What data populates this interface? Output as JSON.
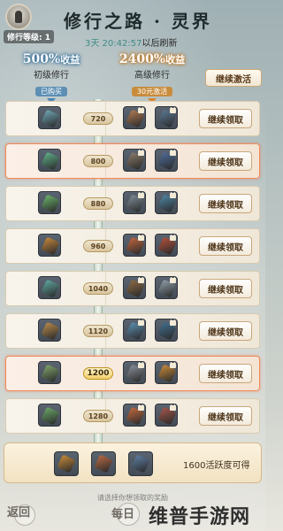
{
  "header": {
    "title": "修行之路 · 灵界",
    "level_label": "修行等级: 1",
    "refresh_countdown": "3天 20:42:57",
    "refresh_suffix": "以后刷新"
  },
  "tiers": {
    "basic": {
      "percent": "500%",
      "bonus": "收益",
      "name": "初级修行",
      "status": "已购买"
    },
    "advanced": {
      "percent": "2400%",
      "bonus": "收益",
      "name": "高级修行",
      "status": "30元激活"
    },
    "activate_button": "继续激活"
  },
  "rows": [
    {
      "threshold": "720",
      "claim": "继续领取",
      "highlighted": false,
      "active_node": false,
      "colors": [
        "#6fa6b5",
        "#b07a52",
        "#5c7a94"
      ]
    },
    {
      "threshold": "800",
      "claim": "继续领取",
      "highlighted": true,
      "active_node": false,
      "colors": [
        "#5fb08a",
        "#8a7a6a",
        "#4e6c9a"
      ]
    },
    {
      "threshold": "880",
      "claim": "继续领取",
      "highlighted": false,
      "active_node": false,
      "colors": [
        "#6cb36b",
        "#7d8c96",
        "#4d86a3"
      ]
    },
    {
      "threshold": "960",
      "claim": "继续领取",
      "highlighted": false,
      "active_node": false,
      "colors": [
        "#c4873b",
        "#c0653e",
        "#b1503c"
      ]
    },
    {
      "threshold": "1040",
      "claim": "继续领取",
      "highlighted": false,
      "active_node": false,
      "colors": [
        "#5ea7a0",
        "#8d6a45",
        "#8fa0a8"
      ]
    },
    {
      "threshold": "1120",
      "claim": "继续领取",
      "highlighted": false,
      "active_node": false,
      "colors": [
        "#b98a4a",
        "#5b8fb0",
        "#3f6f8f"
      ]
    },
    {
      "threshold": "1200",
      "claim": "继续领取",
      "highlighted": true,
      "active_node": true,
      "colors": [
        "#7fa36a",
        "#8a8f99",
        "#c98a3a"
      ]
    },
    {
      "threshold": "1280",
      "claim": "继续领取",
      "highlighted": false,
      "active_node": false,
      "colors": [
        "#6aa86a",
        "#c46a3e",
        "#a5564a"
      ]
    }
  ],
  "reward": {
    "text": "1600活跃度可得",
    "colors": [
      "#c88a3a",
      "#b86a44",
      "#5e7fa5"
    ]
  },
  "hint": "请选择你想领取的奖励",
  "nav": {
    "back_label": "返回",
    "daily_label": "每日"
  },
  "watermark": "维普手游网"
}
